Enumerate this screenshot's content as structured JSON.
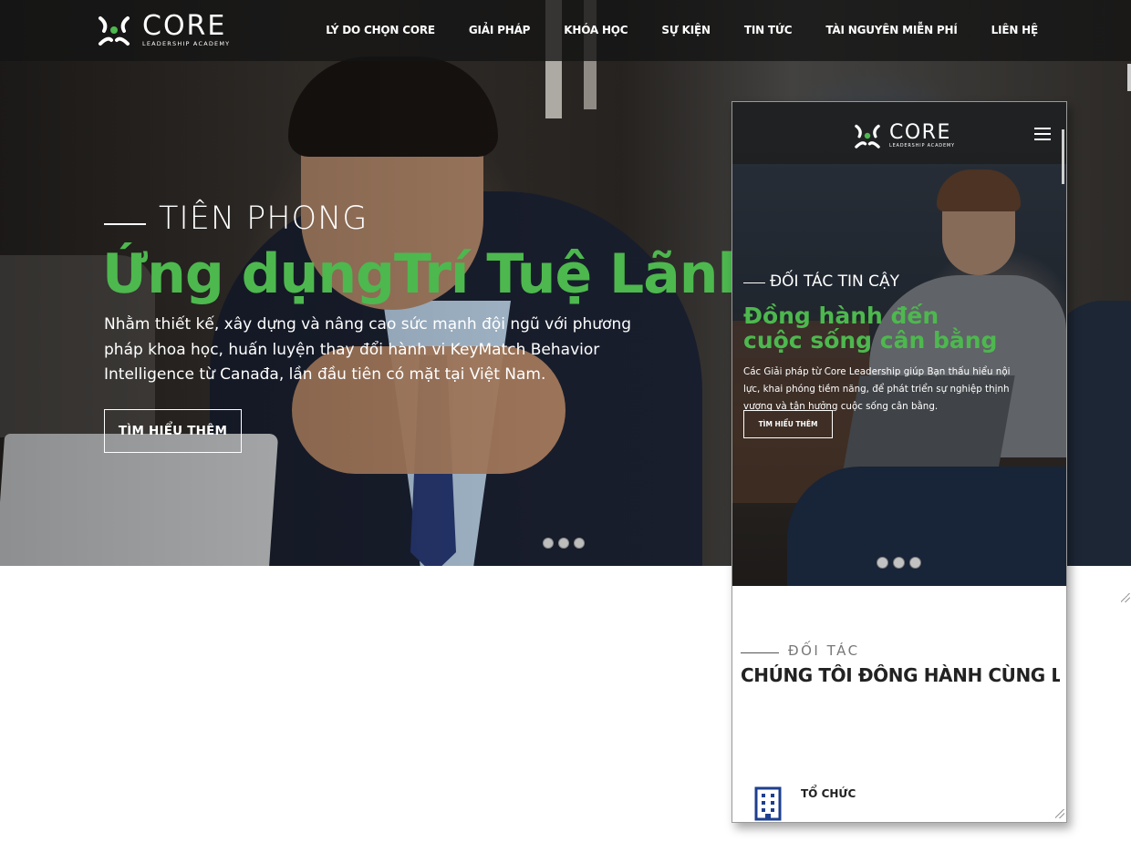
{
  "desktop": {
    "logo": {
      "word": "CORE",
      "sub": "LEADERSHIP ACADEMY"
    },
    "nav": [
      {
        "label": "LÝ DO CHỌN CORE"
      },
      {
        "label": "GIẢI PHÁP"
      },
      {
        "label": "KHÓA HỌC"
      },
      {
        "label": "SỰ KIỆN"
      },
      {
        "label": "TIN TỨC"
      },
      {
        "label": "TÀI NGUYÊN MIỄN PHÍ"
      },
      {
        "label": "LIÊN HỆ"
      }
    ],
    "hero": {
      "kicker": "TIÊN PHONG",
      "headline": "Ứng dụngTrí Tuệ Lãnh Đ",
      "description": "Nhằm thiết kế, xây dựng và nâng cao sức mạnh đội ngũ với phương pháp khoa học, huấn luyện thay đổi hành vi KeyMatch Behavior Intelligence từ Canađa, lần đầu tiên có mặt tại Việt Nam.",
      "cta": "TÌM HIỂU THÊM",
      "slide_count": 3
    }
  },
  "mobile": {
    "logo": {
      "word": "CORE",
      "sub": "LEADERSHIP ACADEMY"
    },
    "menu_icon": "hamburger-icon",
    "hero": {
      "kicker": "ĐỐI TÁC TIN CẬY",
      "headline_line1": "Đồng hành đến",
      "headline_line2": "cuộc sống cân bằng",
      "description": "Các Giải pháp từ Core Leadership giúp Bạn thấu hiểu nội lực, khai phóng tiềm năng, để phát triển sự nghiệp thịnh vượng và tận hưởng cuộc sống cân bằng.",
      "cta": "TÌM HIỂU THÊM",
      "slide_count": 3
    },
    "partners": {
      "kicker": "ĐỐI TÁC",
      "title": "CHÚNG TÔI ĐỒNG HÀNH CÙNG LÀ...",
      "items": [
        {
          "label": "TỔ CHỨC",
          "icon": "building-icon"
        }
      ]
    }
  },
  "colors": {
    "accent_green": "#4db84e",
    "text_white": "#ffffff",
    "icon_blue": "#1e3f8f"
  }
}
